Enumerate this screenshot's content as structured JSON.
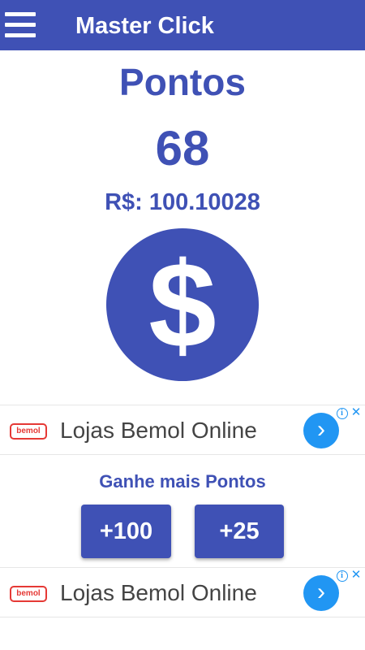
{
  "app_bar": {
    "title": "Master Click",
    "background": "#3f51b5",
    "menu_icon": "hamburger-menu-icon"
  },
  "score": {
    "label": "Pontos",
    "value": "68",
    "balance": "R$: 100.10028",
    "click_icon": "dollar-icon",
    "click_glyph": "$"
  },
  "ads": [
    {
      "logo_text": "bemol",
      "text": "Lojas Bemol Online",
      "arrow_glyph": "›",
      "info_glyph": "i",
      "close_glyph": "✕"
    },
    {
      "logo_text": "bemol",
      "text": "Lojas Bemol Online",
      "arrow_glyph": "›",
      "info_glyph": "i",
      "close_glyph": "✕"
    }
  ],
  "bonus": {
    "label": "Ganhe mais Pontos",
    "buttons": [
      {
        "label": "+100"
      },
      {
        "label": "+25"
      }
    ]
  },
  "colors": {
    "primary": "#3f51b5",
    "ad_accent": "#2196f3",
    "ad_logo": "#e53935"
  }
}
